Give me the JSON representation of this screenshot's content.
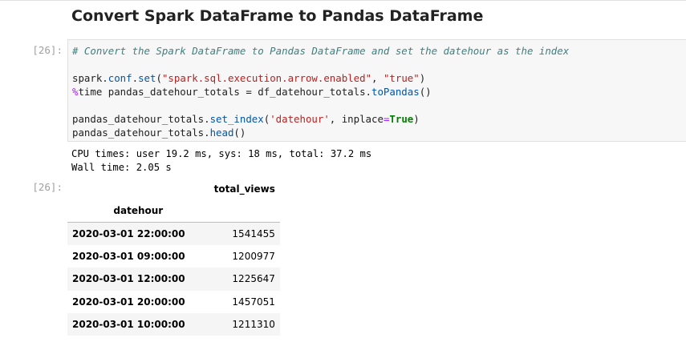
{
  "notebook": {
    "heading": "Convert Spark DataFrame to Pandas DataFrame",
    "input_prompt": "[26]:",
    "output_prompt": "[26]:",
    "code": {
      "comment": "# Convert the Spark DataFrame to Pandas DataFrame and set the datehour as the index",
      "line2": {
        "a": "spark.",
        "b": "conf",
        "c": ".",
        "d": "set",
        "e": "(",
        "f": "\"spark.sql.execution.arrow.enabled\"",
        "g": ", ",
        "h": "\"true\"",
        "i": ")"
      },
      "line3": {
        "a": "%",
        "b": "time pandas_datehour_totals = df_datehour_totals.",
        "c": "toPandas",
        "d": "()"
      },
      "line5": {
        "a": "pandas_datehour_totals.",
        "b": "set_index",
        "c": "(",
        "d": "'datehour'",
        "e": ", inplace",
        "f": "=",
        "g": "True",
        "h": ")"
      },
      "line6": {
        "a": "pandas_datehour_totals.",
        "b": "head",
        "c": "()"
      }
    },
    "stdout": {
      "line1": "CPU times: user 19.2 ms, sys: 18 ms, total: 37.2 ms",
      "line2": "Wall time: 2.05 s"
    },
    "table": {
      "column_header": "total_views",
      "index_header": "datehour",
      "rows": [
        {
          "datehour": "2020-03-01 22:00:00",
          "total_views": "1541455"
        },
        {
          "datehour": "2020-03-01 09:00:00",
          "total_views": "1200977"
        },
        {
          "datehour": "2020-03-01 12:00:00",
          "total_views": "1225647"
        },
        {
          "datehour": "2020-03-01 20:00:00",
          "total_views": "1457051"
        },
        {
          "datehour": "2020-03-01 10:00:00",
          "total_views": "1211310"
        }
      ]
    }
  }
}
